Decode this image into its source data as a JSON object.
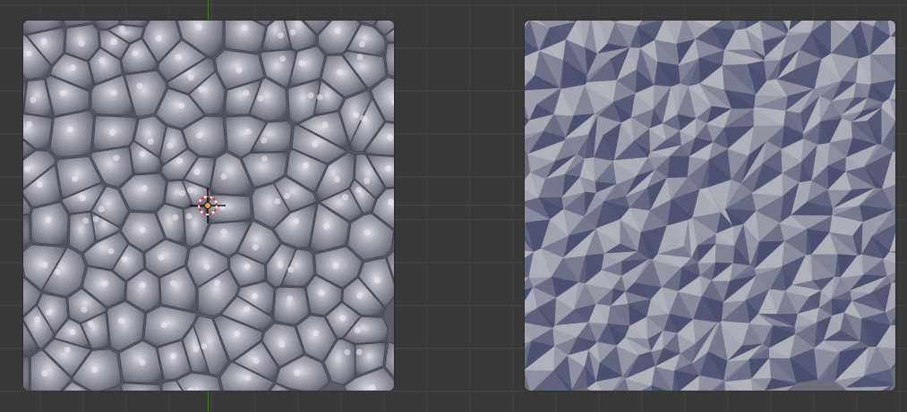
{
  "viewport": {
    "background_color": "#393939",
    "grid_color": "#434343",
    "x_axis_color": "#7a2f2f",
    "y_axis_color": "#3f7a2f"
  },
  "planes": [
    {
      "id": "left",
      "shading": "smooth",
      "base_color": "#8f8f99",
      "highlight_color": "#d9d9df",
      "shadow_color": "#4e4e5c"
    },
    {
      "id": "right",
      "shading": "faceted",
      "base_color": "#8c8c95",
      "highlight_color": "#b8b8bc",
      "shadow_color": "#4d4f6f"
    }
  ],
  "cursor": {
    "icon": "3d-cursor-icon",
    "ring_color": "#d13b3b",
    "center_color": "#e8a040"
  }
}
